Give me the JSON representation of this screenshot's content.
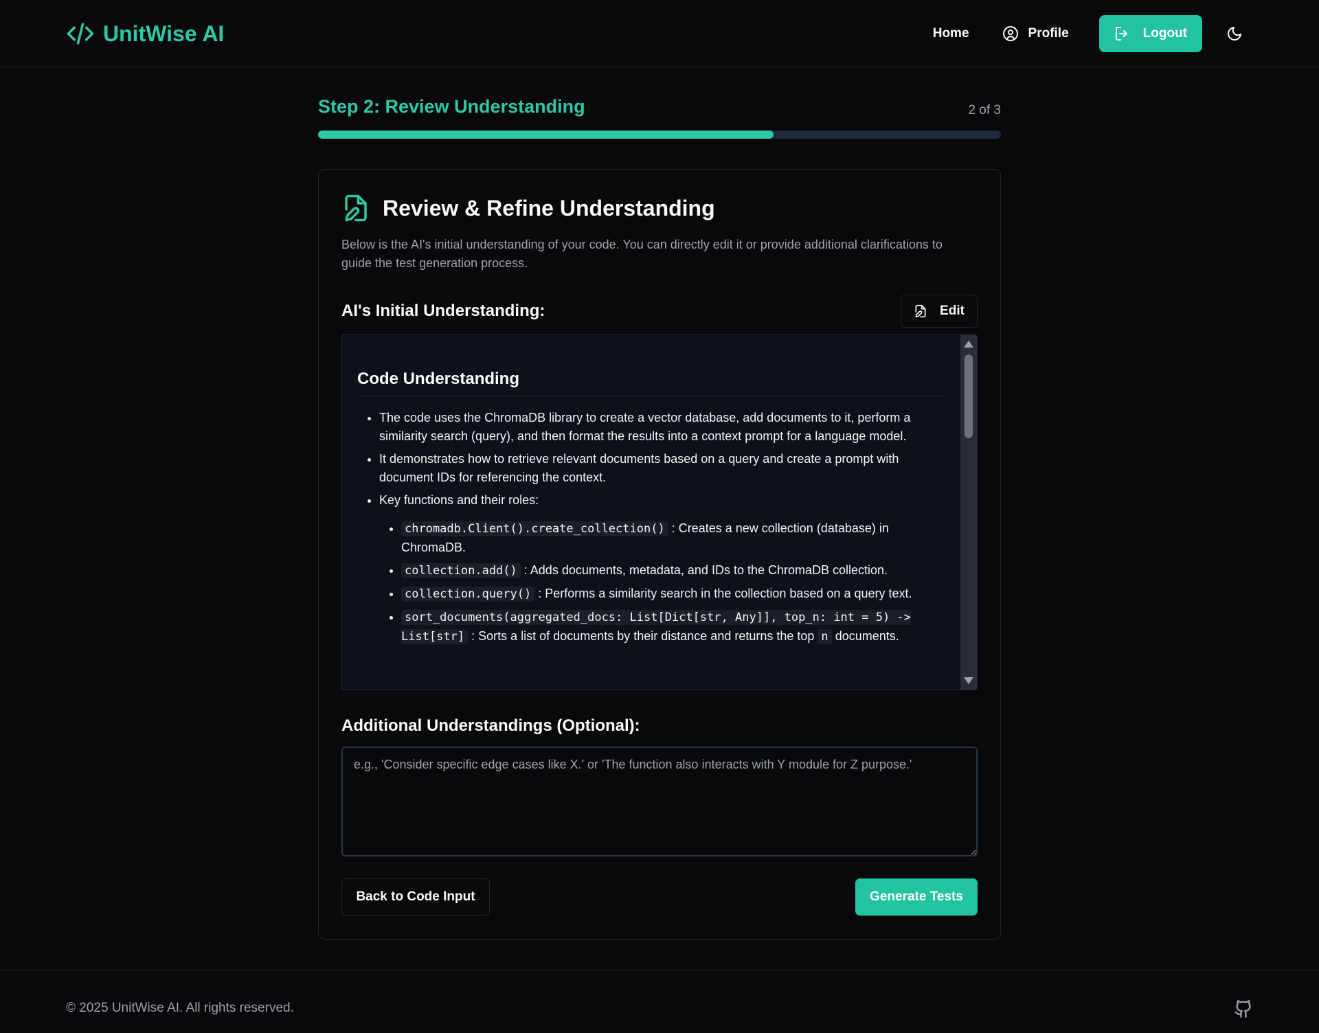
{
  "app": {
    "brand": "UnitWise AI",
    "brand_icon": "code-icon",
    "accent_color": "#2cc9a2"
  },
  "nav": {
    "home": "Home",
    "profile": "Profile",
    "logout": "Logout",
    "theme_icon": "moon-icon"
  },
  "step": {
    "title": "Step 2: Review Understanding",
    "count": "2 of 3",
    "progress": 0.667
  },
  "card": {
    "icon": "file-edit-icon",
    "title": "Review & Refine Understanding",
    "description": "Below is the AI's initial understanding of your code. You can directly edit it or provide additional clarifications to guide the test generation process.",
    "initial_title": "AI's Initial Understanding:",
    "edit_label": "Edit",
    "understanding": {
      "heading": "Code Understanding",
      "bullet_1": "The code uses the ChromaDB library to create a vector database, add documents to it, perform a similarity search (query), and then format the results into a context prompt for a language model.",
      "bullet_2": "It demonstrates how to retrieve relevant documents based on a query and create a prompt with document IDs for referencing the context.",
      "bullet_3": "Key functions and their roles:",
      "sub": [
        {
          "code": "chromadb.Client().create_collection()",
          "text": ": Creates a new collection (database) in ChromaDB."
        },
        {
          "code": "collection.add()",
          "text": ": Adds documents, metadata, and IDs to the ChromaDB collection."
        },
        {
          "code": "collection.query()",
          "text": ": Performs a similarity search in the collection based on a query text."
        },
        {
          "code": "sort_documents(aggregated_docs: List[Dict[str, Any]], top_n: int = 5) -> List[str]",
          "text": ": Sorts a list of documents by their distance and returns the top",
          "code2": "n",
          "text2": "documents."
        }
      ]
    },
    "additional_title": "Additional Understandings (Optional):",
    "additional_placeholder": "e.g., 'Consider specific edge cases like X.' or 'The function also interacts with Y module for Z purpose.'",
    "back_label": "Back to Code Input",
    "generate_label": "Generate Tests"
  },
  "footer": {
    "copyright": "© 2025 UnitWise AI. All rights reserved.",
    "github_icon": "github-icon"
  }
}
